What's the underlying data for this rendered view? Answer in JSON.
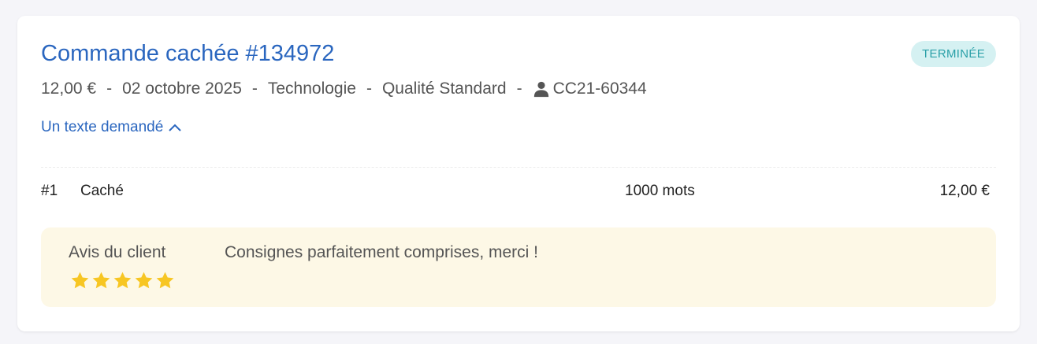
{
  "order": {
    "title": "Commande cachée #134972",
    "status": "TERMINÉE",
    "status_color": "#2aa0a8",
    "price": "12,00 €",
    "date": "02 octobre 2025",
    "category": "Technologie",
    "quality": "Qualité Standard",
    "client_code": "CC21-60344",
    "separator": "-",
    "toggle_label": "Un texte demandé"
  },
  "items": [
    {
      "index": "#1",
      "title": "Caché",
      "words": "1000 mots",
      "price": "12,00 €"
    }
  ],
  "review": {
    "label": "Avis du client",
    "text": "Consignes parfaitement comprises, merci !",
    "rating": 5,
    "max_rating": 5,
    "star_color": "#f7c623"
  },
  "icons": {
    "user": "user-icon",
    "chevron": "chevron-up-icon",
    "star": "star-icon"
  },
  "colors": {
    "link": "#2a66bf",
    "review_bg": "#fdf8e6",
    "badge_bg": "#d5f1f2"
  }
}
